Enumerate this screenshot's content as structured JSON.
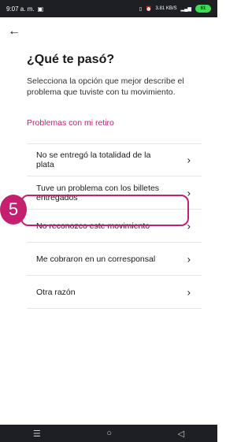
{
  "status": {
    "time": "9:07 a. m.",
    "signal_text": "3.81 KB/S",
    "battery": "61"
  },
  "header": {
    "title": "¿Qué te pasó?",
    "subtitle": "Selecciona la opción que mejor describe el problema que tuviste con tu movimiento."
  },
  "section": {
    "label": "Problemas con mi retiro"
  },
  "options": [
    {
      "label": "No se entregó la totalidad de la plata"
    },
    {
      "label": "Tuve un problema con los billetes entregados"
    },
    {
      "label": "No reconozco este movimiento"
    },
    {
      "label": "Me cobraron en un corresponsal"
    },
    {
      "label": "Otra razón"
    }
  ],
  "annotation": {
    "step": "5",
    "color": "#c4206f"
  },
  "nav": {
    "recent": "☰",
    "home": "○",
    "back": "◁"
  }
}
